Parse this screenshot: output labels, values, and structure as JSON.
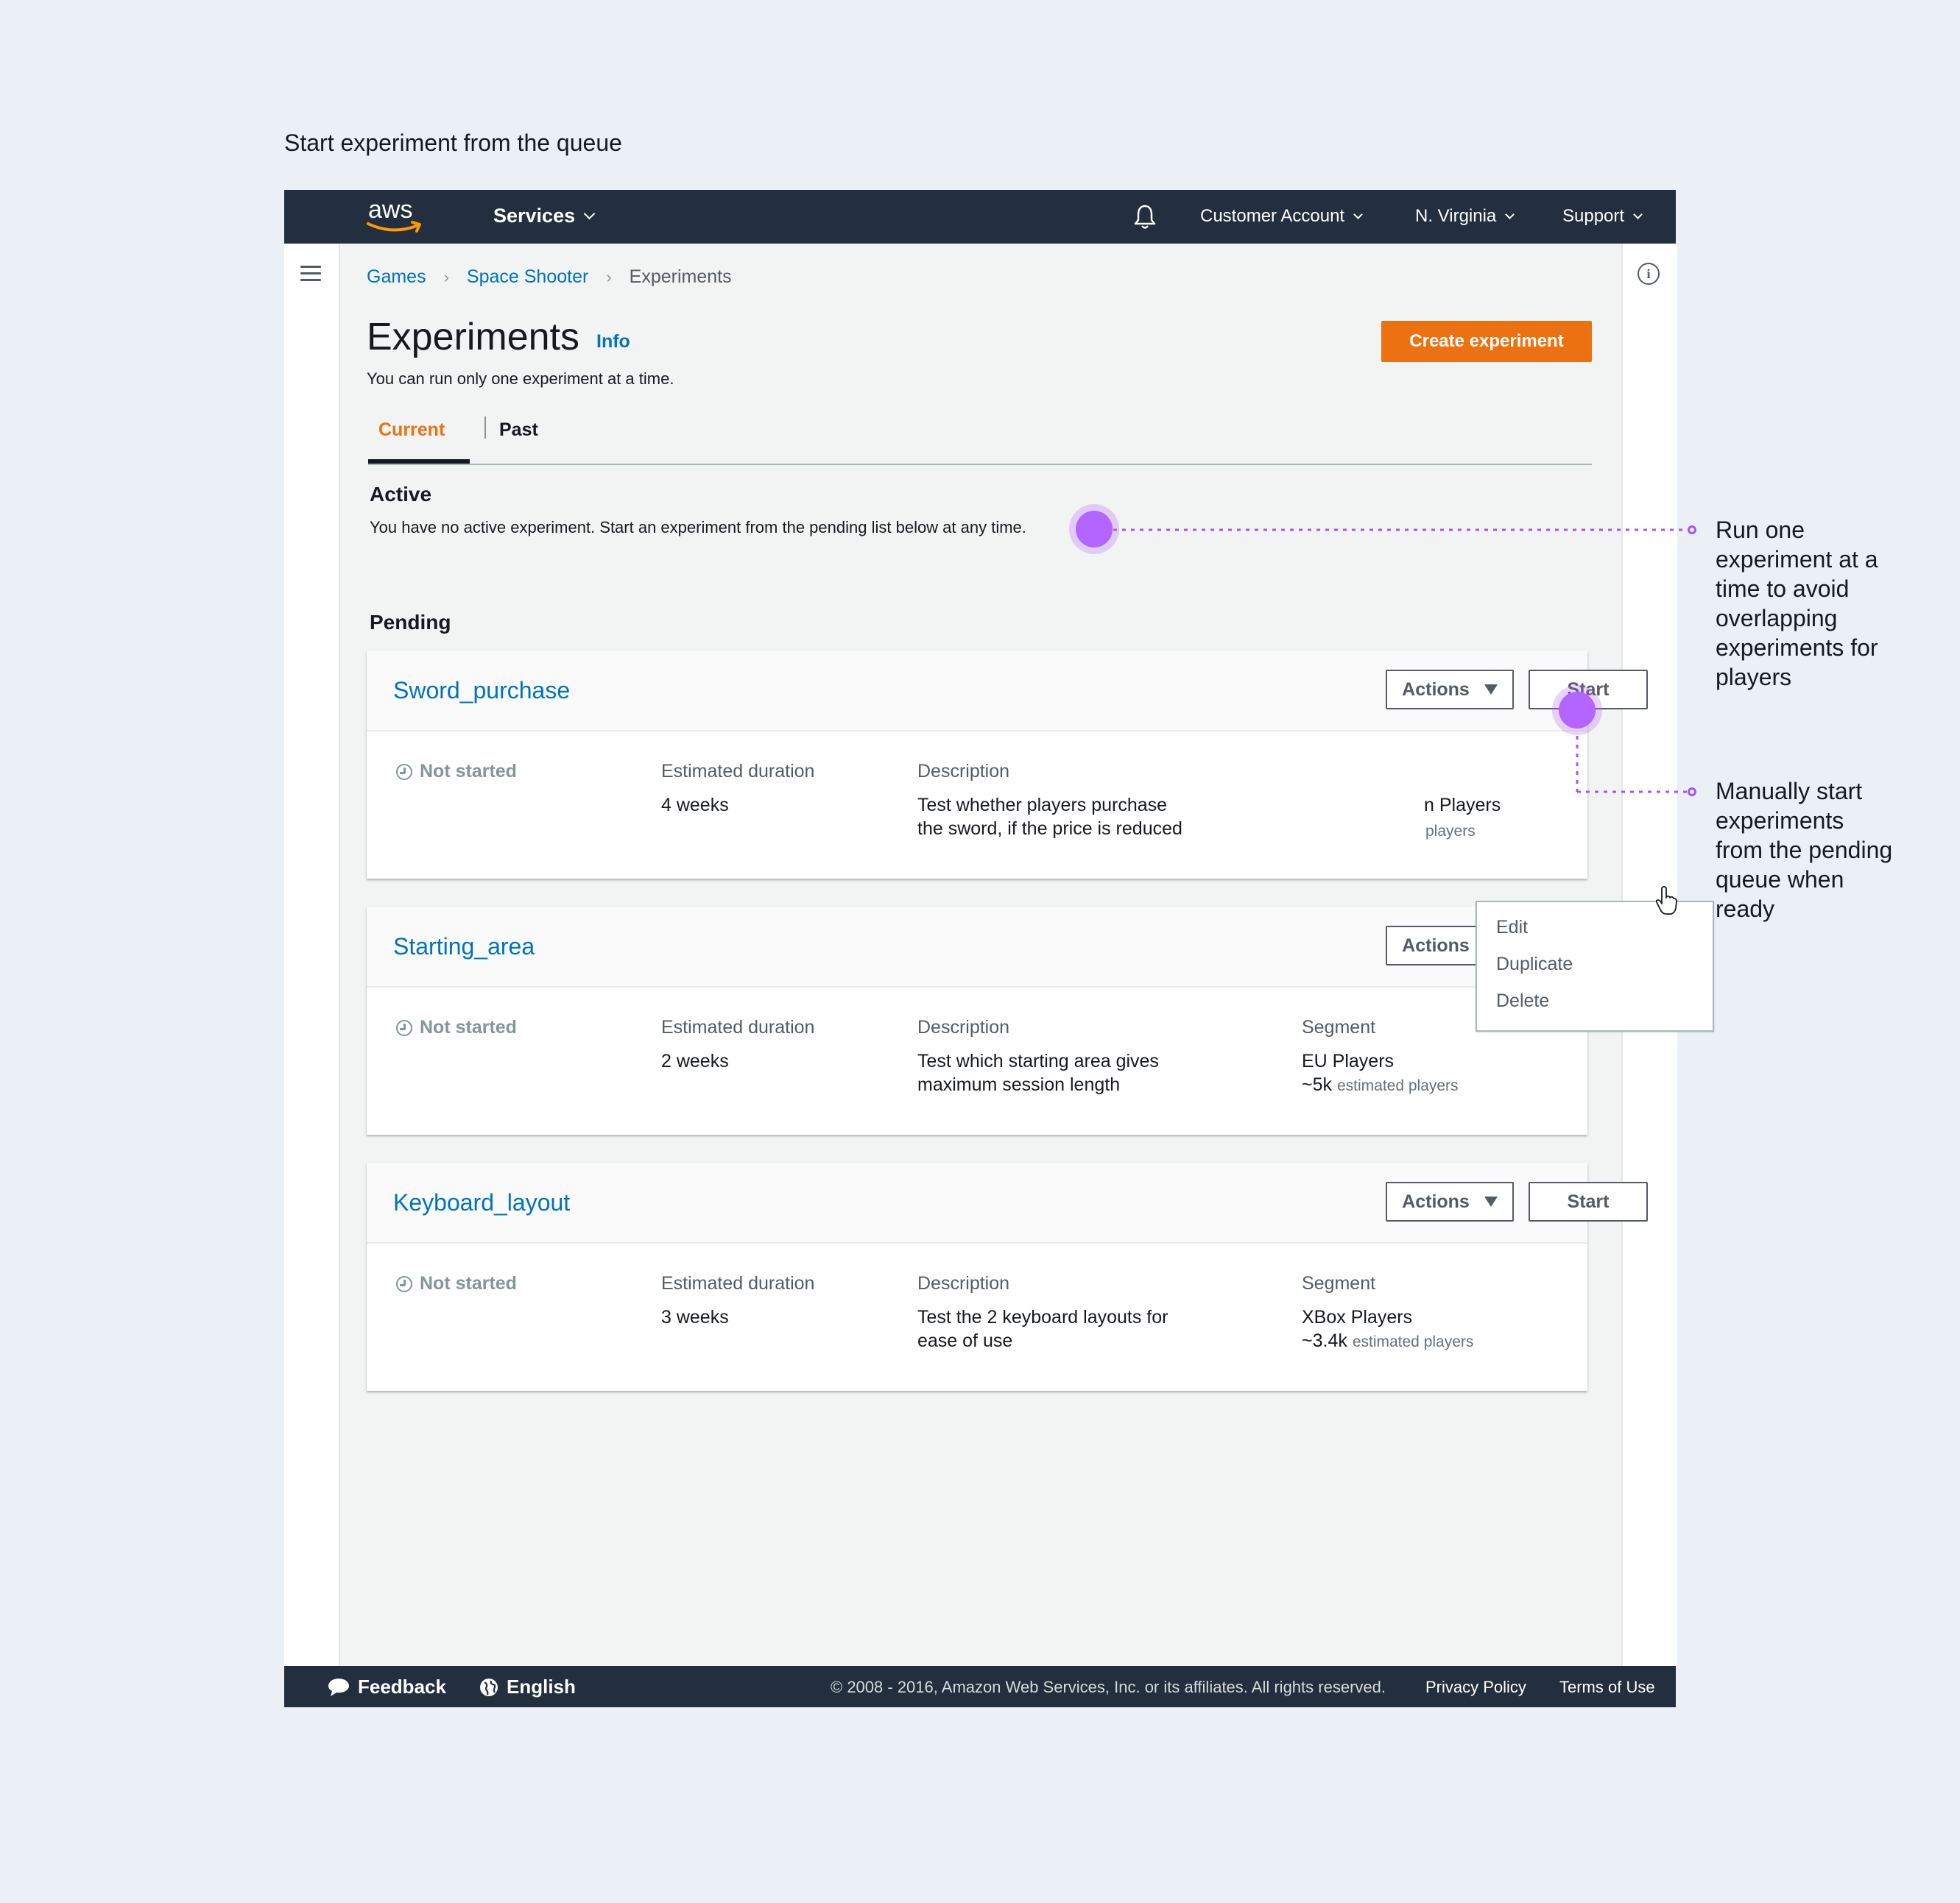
{
  "page_caption": "Start experiment from the queue",
  "topnav": {
    "services_label": "Services",
    "account_label": "Customer Account",
    "region_label": "N. Virginia",
    "support_label": "Support"
  },
  "breadcrumb": [
    "Games",
    "Space Shooter",
    "Experiments"
  ],
  "header": {
    "title": "Experiments",
    "info_link": "Info",
    "subtitle": "You can run only one experiment at a time.",
    "create_button": "Create experiment"
  },
  "tabs": [
    "Current",
    "Past"
  ],
  "active": {
    "heading": "Active",
    "text": "You have no active experiment. Start an experiment from the pending list below at any time."
  },
  "pending": {
    "heading": "Pending",
    "actions_label": "Actions",
    "start_label": "Start",
    "status_label": "Not started",
    "duration_label": "Estimated duration",
    "description_label": "Description",
    "segment_label": "Segment",
    "estimated_suffix": "estimated players",
    "experiments": [
      {
        "name": "Sword_purchase",
        "duration": "4 weeks",
        "description_line1": "Test whether players purchase",
        "description_line2": "the sword, if the price is reduced",
        "segment_visible": "n Players",
        "estimated_visible": "players"
      },
      {
        "name": "Starting_area",
        "duration": "2 weeks",
        "description_line1": "Test which starting area gives",
        "description_line2": "maximum session length",
        "segment": "EU Players",
        "players": "~5k"
      },
      {
        "name": "Keyboard_layout",
        "duration": "3 weeks",
        "description_line1": "Test the 2 keyboard layouts for",
        "description_line2": "ease of use",
        "segment": "XBox Players",
        "players": "~3.4k"
      }
    ]
  },
  "dropdown": {
    "items": [
      "Edit",
      "Duplicate",
      "Delete"
    ]
  },
  "annotations": {
    "run_one": [
      "Run one",
      "experiment at a",
      "time to avoid",
      "overlapping",
      "experiments for",
      "players"
    ],
    "manual_start": [
      "Manually start",
      "experiments",
      "from the pending",
      "queue when",
      "ready"
    ]
  },
  "footer": {
    "feedback": "Feedback",
    "language": "English",
    "copyright": "© 2008 - 2016, Amazon Web Services, Inc. or its affiliates. All rights reserved.",
    "privacy": "Privacy Policy",
    "terms": "Terms of Use"
  },
  "colors": {
    "nav_bg": "#232f3e",
    "link": "#0073bb",
    "primary_button": "#ec7211",
    "annotation_accent": "#b464ff",
    "page_bg": "#ebeff6"
  }
}
